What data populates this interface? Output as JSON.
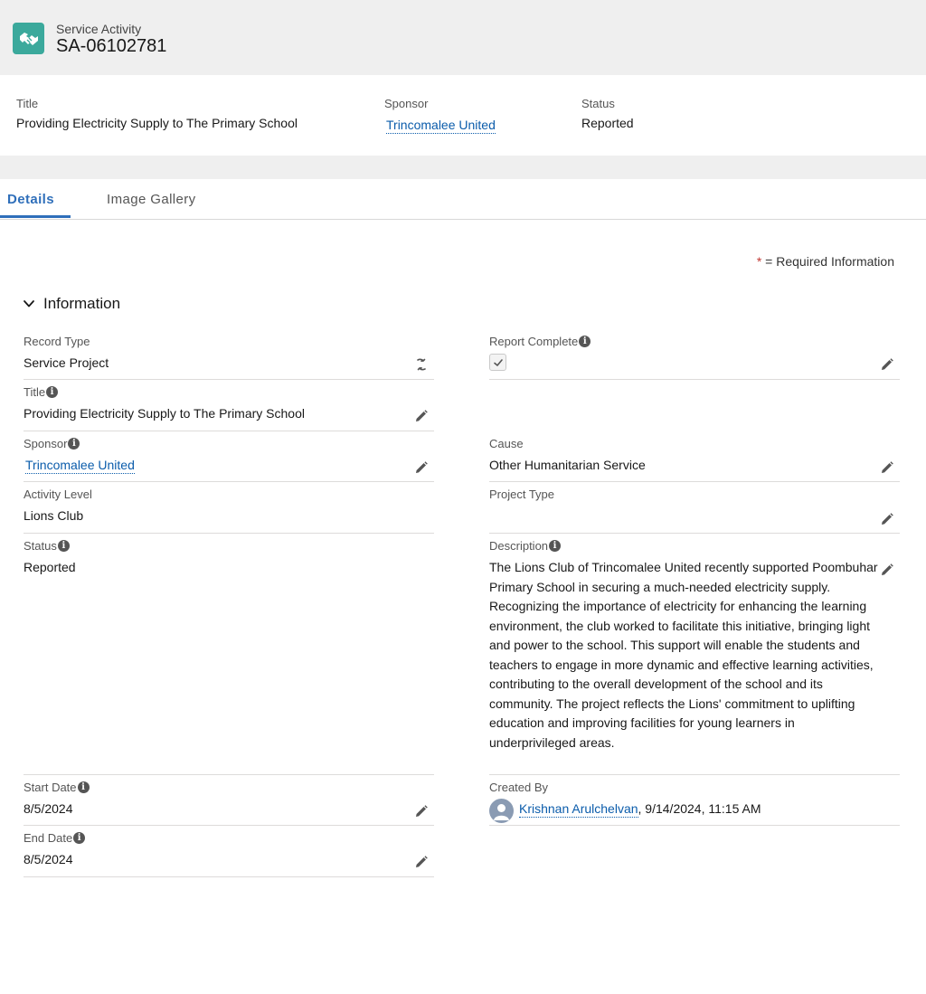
{
  "header": {
    "object_label": "Service Activity",
    "record_name": "SA-06102781",
    "icon": "handshake-icon",
    "icon_color": "#3ba99c"
  },
  "highlights": {
    "title_label": "Title",
    "title_value": "Providing Electricity Supply to The Primary School",
    "sponsor_label": "Sponsor",
    "sponsor_value": "Trincomalee United",
    "status_label": "Status",
    "status_value": "Reported"
  },
  "tabs": [
    {
      "label": "Details",
      "active": true
    },
    {
      "label": "Image Gallery",
      "active": false
    }
  ],
  "required_info": {
    "star": "*",
    "text": " = Required Information"
  },
  "section": {
    "title": "Information",
    "expanded": true
  },
  "fields": {
    "record_type": {
      "label": "Record Type",
      "value": "Service Project"
    },
    "report_complete": {
      "label": "Report Complete",
      "checked": true
    },
    "title": {
      "label": "Title",
      "value": "Providing Electricity Supply to The Primary School"
    },
    "sponsor": {
      "label": "Sponsor",
      "value": "Trincomalee United"
    },
    "cause": {
      "label": "Cause",
      "value": "Other Humanitarian Service"
    },
    "activity_level": {
      "label": "Activity Level",
      "value": "Lions Club"
    },
    "project_type": {
      "label": "Project Type",
      "value": ""
    },
    "status": {
      "label": "Status",
      "value": "Reported"
    },
    "description": {
      "label": "Description",
      "value": "The Lions Club of Trincomalee United recently supported Poombuhar Primary School in securing a much-needed electricity supply. Recognizing the importance of electricity for enhancing the learning environment, the club worked to facilitate this initiative, bringing light and power to the school. This support will enable the students and teachers to engage in more dynamic and effective learning activities, contributing to the overall development of the school and its community. The project reflects the Lions' commitment to uplifting education and improving facilities for young learners in underprivileged areas."
    },
    "start_date": {
      "label": "Start Date",
      "value": "8/5/2024"
    },
    "end_date": {
      "label": "End Date",
      "value": "8/5/2024"
    },
    "created_by": {
      "label": "Created By",
      "user": "Krishnan Arulchelvan",
      "timestamp": ", 9/14/2024, 11:15 AM"
    }
  },
  "colors": {
    "link": "#0b5cab",
    "active_tab": "#2f6fba",
    "required_star": "#c23934"
  }
}
